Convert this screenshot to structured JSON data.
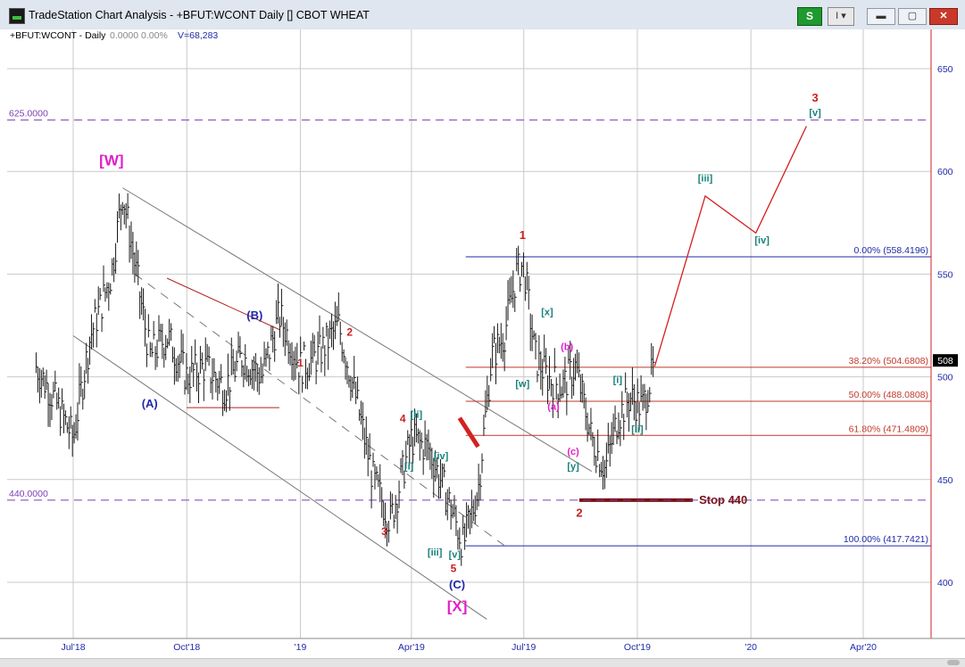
{
  "window": {
    "title": "TradeStation Chart Analysis - +BFUT:WCONT Daily [] CBOT WHEAT",
    "strategy_button": "S",
    "indicator_button": "I ▾",
    "minimize_label": "▬",
    "restore_label": "▢",
    "close_label": "✕"
  },
  "chart_info": {
    "symbol_line": "+BFUT:WCONT - Daily",
    "values_line": "0.0000  0.00%",
    "volume_line": "V=68,283"
  },
  "chart_data": {
    "type": "line",
    "title": "",
    "xlabel": "",
    "ylabel": "",
    "ylim": [
      375,
      660
    ],
    "y_ticks": [
      400,
      450,
      500,
      550,
      600,
      650
    ],
    "x_tick_labels": [
      "Jul'18",
      "Oct'18",
      "'19",
      "Apr'19",
      "Jul'19",
      "Oct'19",
      "'20",
      "Apr'20"
    ],
    "last_price": "508",
    "series": [
      {
        "values_x": [
          "2018-06-01",
          "2018-06-15",
          "2018-07-01",
          "2018-07-15",
          "2018-08-01",
          "2018-08-10",
          "2018-08-20",
          "2018-09-01",
          "2018-09-15",
          "2018-10-01",
          "2018-10-15",
          "2018-11-01",
          "2018-11-15",
          "2018-12-01",
          "2018-12-15",
          "2019-01-01",
          "2019-01-15",
          "2019-02-01",
          "2019-02-15",
          "2019-03-01",
          "2019-03-15",
          "2019-04-01",
          "2019-04-15",
          "2019-05-01",
          "2019-05-13",
          "2019-05-25",
          "2019-06-05",
          "2019-06-15",
          "2019-06-25",
          "2019-07-01",
          "2019-07-10",
          "2019-07-20",
          "2019-08-01",
          "2019-08-12",
          "2019-08-25",
          "2019-09-05",
          "2019-09-15",
          "2019-09-25",
          "2019-10-05",
          "2019-10-15"
        ],
        "values": [
          505,
          490,
          470,
          520,
          550,
          590,
          555,
          510,
          520,
          500,
          505,
          495,
          510,
          500,
          530,
          505,
          510,
          525,
          490,
          450,
          430,
          470,
          465,
          440,
          418,
          445,
          510,
          520,
          550,
          555,
          510,
          500,
          495,
          505,
          470,
          455,
          480,
          490,
          485,
          505
        ]
      }
    ],
    "projection": {
      "x": [
        "2019-10-15",
        "2019-11-25",
        "2020-01-05",
        "2020-02-15"
      ],
      "values": [
        505,
        588,
        570,
        622
      ]
    }
  },
  "horizontal_levels": [
    {
      "value": 625,
      "label": "625.0000",
      "style": "dash",
      "color": "#7a3fb0"
    },
    {
      "value": 440,
      "label": "440.0000",
      "style": "dash",
      "color": "#7a3fb0"
    },
    {
      "value": 558.4196,
      "label": "0.00% (558.4196)",
      "color": "#1f2aa8"
    },
    {
      "value": 504.6808,
      "label": "38.20% (504.6808)",
      "color": "#c0392b"
    },
    {
      "value": 488.0808,
      "label": "50.00% (488.0808)",
      "color": "#c0392b"
    },
    {
      "value": 471.4809,
      "label": "61.80% (471.4809)",
      "color": "#c0392b"
    },
    {
      "value": 417.7421,
      "label": "100.00% (417.7421)",
      "color": "#1f2aa8"
    }
  ],
  "wave_labels": [
    {
      "text": "[W]",
      "color": "#e020c8"
    },
    {
      "text": "(A)",
      "color": "#1f2aa8"
    },
    {
      "text": "(B)",
      "color": "#1f2aa8"
    },
    {
      "text": "1",
      "color": "#cc1f1f"
    },
    {
      "text": "2",
      "color": "#cc1f1f"
    },
    {
      "text": "3",
      "color": "#cc1f1f"
    },
    {
      "text": "4",
      "color": "#cc1f1f"
    },
    {
      "text": "5",
      "color": "#cc1f1f"
    },
    {
      "text": "(C)",
      "color": "#1f2aa8"
    },
    {
      "text": "[X]",
      "color": "#e020c8"
    },
    {
      "text": "[i]",
      "color": "#16827a"
    },
    {
      "text": "[ii]",
      "color": "#16827a"
    },
    {
      "text": "[iii]",
      "color": "#16827a"
    },
    {
      "text": "[iv]",
      "color": "#16827a"
    },
    {
      "text": "[v]",
      "color": "#16827a"
    },
    {
      "text": "1",
      "color": "#cc1f1f"
    },
    {
      "text": "[w]",
      "color": "#16827a"
    },
    {
      "text": "[x]",
      "color": "#16827a"
    },
    {
      "text": "(a)",
      "color": "#e020c8"
    },
    {
      "text": "(b)",
      "color": "#e020c8"
    },
    {
      "text": "(c)",
      "color": "#e020c8"
    },
    {
      "text": "[y]",
      "color": "#16827a"
    },
    {
      "text": "2",
      "color": "#cc1f1f"
    },
    {
      "text": "[i]",
      "color": "#16827a"
    },
    {
      "text": "[ii]",
      "color": "#16827a"
    },
    {
      "text": "[iii]",
      "color": "#16827a"
    },
    {
      "text": "[iv]",
      "color": "#16827a"
    },
    {
      "text": "[v]",
      "color": "#16827a"
    },
    {
      "text": "3",
      "color": "#cc1f1f"
    }
  ],
  "stop_label": "Stop 440",
  "colors": {
    "price_bars": "#1a1a1a",
    "projection": "#d42020",
    "stop_line": "#7a0f0f",
    "grid": "#c9c9c9",
    "axis_red": "#d42020"
  }
}
